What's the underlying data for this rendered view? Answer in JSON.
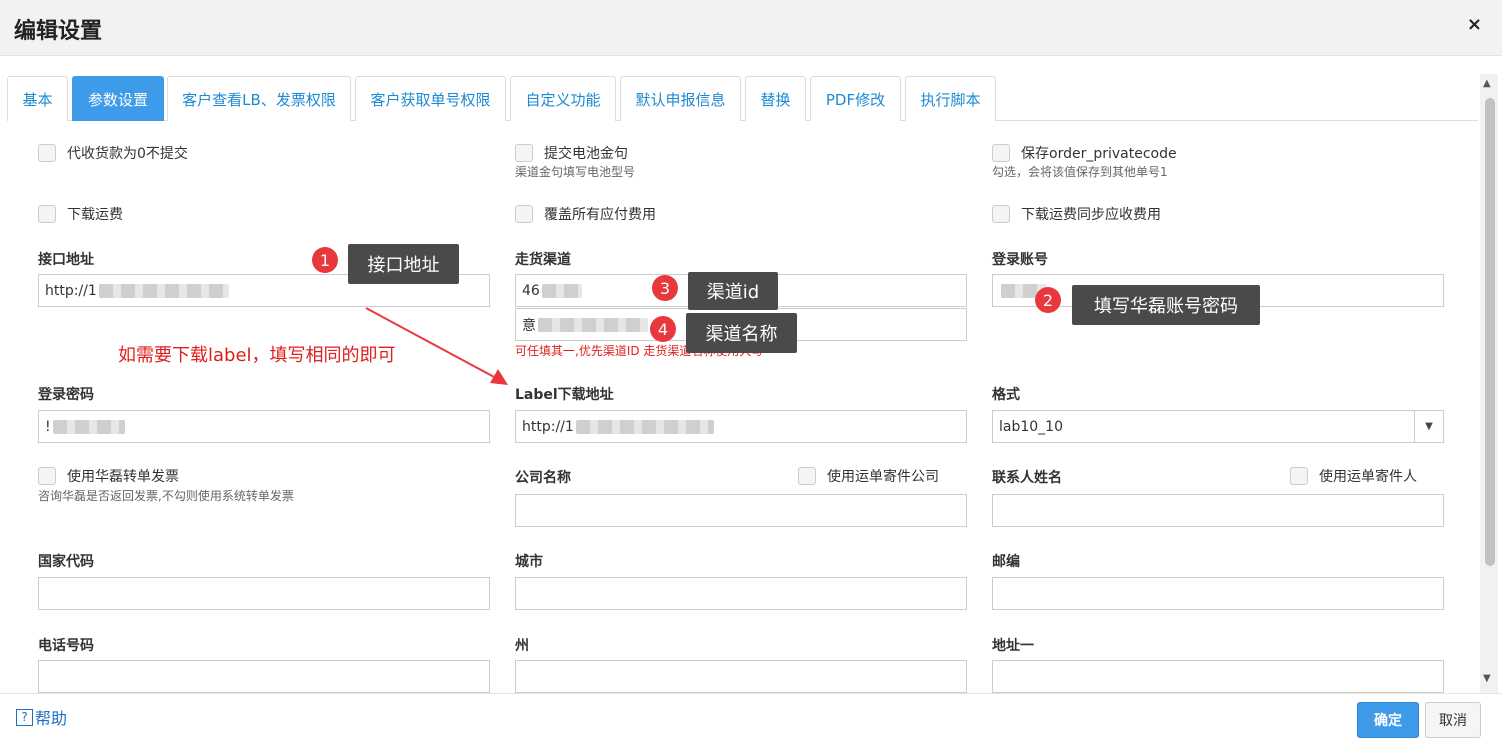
{
  "dialog": {
    "title": "编辑设置",
    "close": "×"
  },
  "tabs": [
    "基本",
    "参数设置",
    "客户查看LB、发票权限",
    "客户获取单号权限",
    "自定义功能",
    "默认申报信息",
    "替换",
    "PDF修改",
    "执行脚本"
  ],
  "checkboxes": {
    "cod_zero": "代收货款为0不提交",
    "battery": "提交电池金句",
    "battery_hint": "渠道金句填写电池型号",
    "privatecode": "保存order_privatecode",
    "privatecode_hint": "勾选，会将该值保存到其他单号1",
    "download_fee": "下载运费",
    "override_payable": "覆盖所有应付费用",
    "sync_receivable": "下载运费同步应收费用",
    "use_invoice": "使用华磊转单发票",
    "use_invoice_hint": "咨询华磊是否返回发票,不勾则使用系统转单发票",
    "use_sender_company": "使用运单寄件公司",
    "use_sender_person": "使用运单寄件人"
  },
  "fields": {
    "api_url_label": "接口地址",
    "api_url_value": "http://1",
    "channel_label": "走货渠道",
    "channel_id_value": "46",
    "channel_name_value": "意",
    "channel_note": "可任填其一,优先渠道ID 走货渠道名称使用大写",
    "login_account_label": "登录账号",
    "login_password_label": "登录密码",
    "password_value": "!",
    "label_url_label": "Label下载地址",
    "label_url_value": "http://1",
    "format_label": "格式",
    "format_value": "lab10_10",
    "company_label": "公司名称",
    "contact_label": "联系人姓名",
    "country_label": "国家代码",
    "city_label": "城市",
    "zip_label": "邮编",
    "phone_label": "电话号码",
    "state_label": "州",
    "address1_label": "地址一"
  },
  "annotations": {
    "n1": "1",
    "c1": "接口地址",
    "n2": "2",
    "c2": "填写华磊账号密码",
    "n3": "3",
    "c3": "渠道id",
    "n4": "4",
    "c4": "渠道名称",
    "red_note": "如需要下载label，填写相同的即可"
  },
  "footer": {
    "help": "帮助",
    "help_icon": "?",
    "ok": "确定",
    "cancel": "取消"
  },
  "colors": {
    "accent": "#3d9be9",
    "annotation_red": "#e8383d",
    "callout_bg": "#4a4a4a"
  }
}
